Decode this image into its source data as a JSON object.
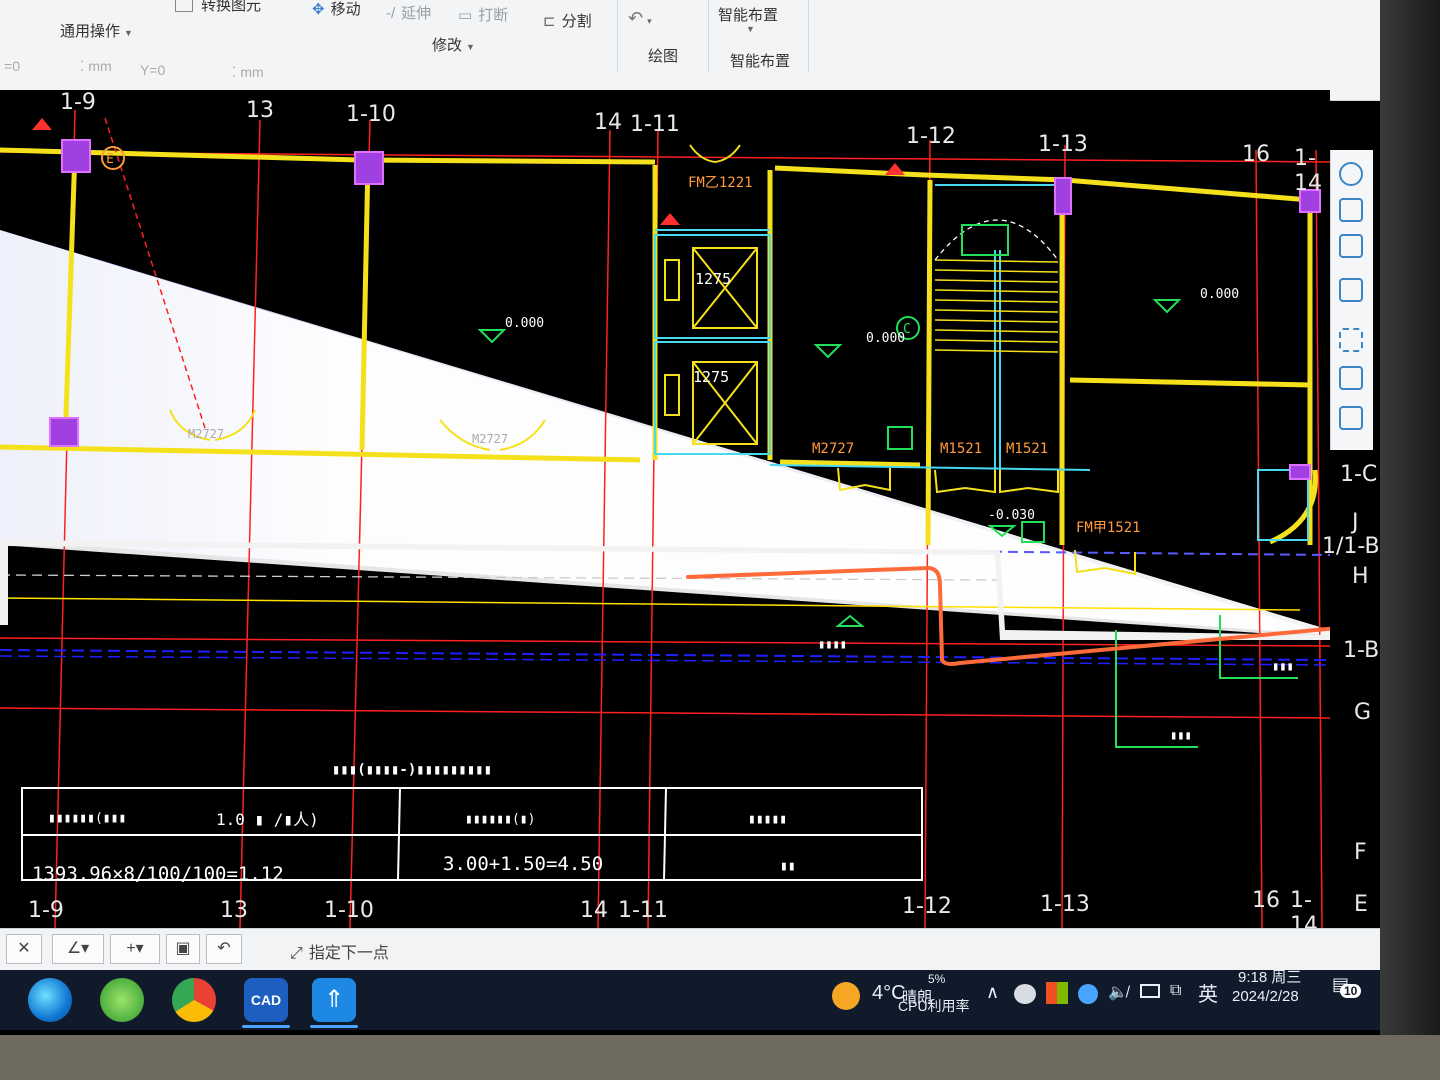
{
  "ribbon": {
    "convert_label": "转换图元",
    "move_label": "移动",
    "extend_label": "延伸",
    "break_label": "打断",
    "split_label": "分割",
    "general_ops_label": "通用操作",
    "modify_label": "修改",
    "draw_label": "绘图",
    "smart_layout_top": "智能布置",
    "smart_layout_bottom": "智能布置",
    "x_value": "0",
    "x_unit": "mm",
    "y_label": "Y=",
    "y_value": "0",
    "y_unit": "mm"
  },
  "drawing": {
    "axis_top": [
      "1-9",
      "13",
      "1-10",
      "14",
      "1-11",
      "1-12",
      "1-13",
      "16",
      "1-14"
    ],
    "axis_bottom": [
      "1-9",
      "13",
      "1-10",
      "14",
      "1-11",
      "1-12",
      "1-13",
      "16",
      "1-14"
    ],
    "axis_right": [
      "1-C",
      "J",
      "1/1-B",
      "H",
      "1-B",
      "G",
      "F",
      "E"
    ],
    "doors": [
      "FM乙1221",
      "M2727",
      "M1521",
      "M1521",
      "FM甲1521",
      "M2727",
      "M2727"
    ],
    "elevator_labels": [
      "1275",
      "1275"
    ],
    "elevations": [
      "0.000",
      "0.000",
      "0.000",
      "-0.030"
    ],
    "grid_circles": [
      "E",
      "C"
    ],
    "table_title": "▮▮▮(▮▮▮▮-)▮▮▮▮▮▮▮▮▮",
    "table_h1": "▮▮▮▮▮▮(▮▮▮",
    "table_h1_value": "1.0  ▮ /▮人)",
    "table_h2": "▮▮▮▮▮▮(▮)",
    "table_h3": "▮▮▮▮▮",
    "table_v1": "1393.96×8/100/100=1.12",
    "table_v2": "3.00+1.50=4.50",
    "table_v3": "▮▮",
    "label_drain": "▮▮▮",
    "label_red": "▮▮▮",
    "label_entry": "▮▮▮▮"
  },
  "cmdbar": {
    "prompt": "指定下一点"
  },
  "taskbar": {
    "apps": [
      "edge-browser",
      "ie-browser",
      "chrome-browser",
      "cad-app",
      "feishu-app"
    ],
    "cad_label": "CAD",
    "weather_temp": "4°C",
    "weather_text": "晴朗",
    "cpu_percent": "5%",
    "cpu_label": "CPU利用率",
    "ime_label": "英",
    "time": "9:18 周三",
    "date": "2024/2/28",
    "notification_count": "10"
  },
  "colors": {
    "wall": "#f5e01c",
    "axis": "#ff2020",
    "door_orange": "#ff9a3c",
    "cyan": "#48d8f0",
    "magenta": "#d040f0",
    "green": "#22e05a",
    "annotation": "#ff7a50"
  }
}
